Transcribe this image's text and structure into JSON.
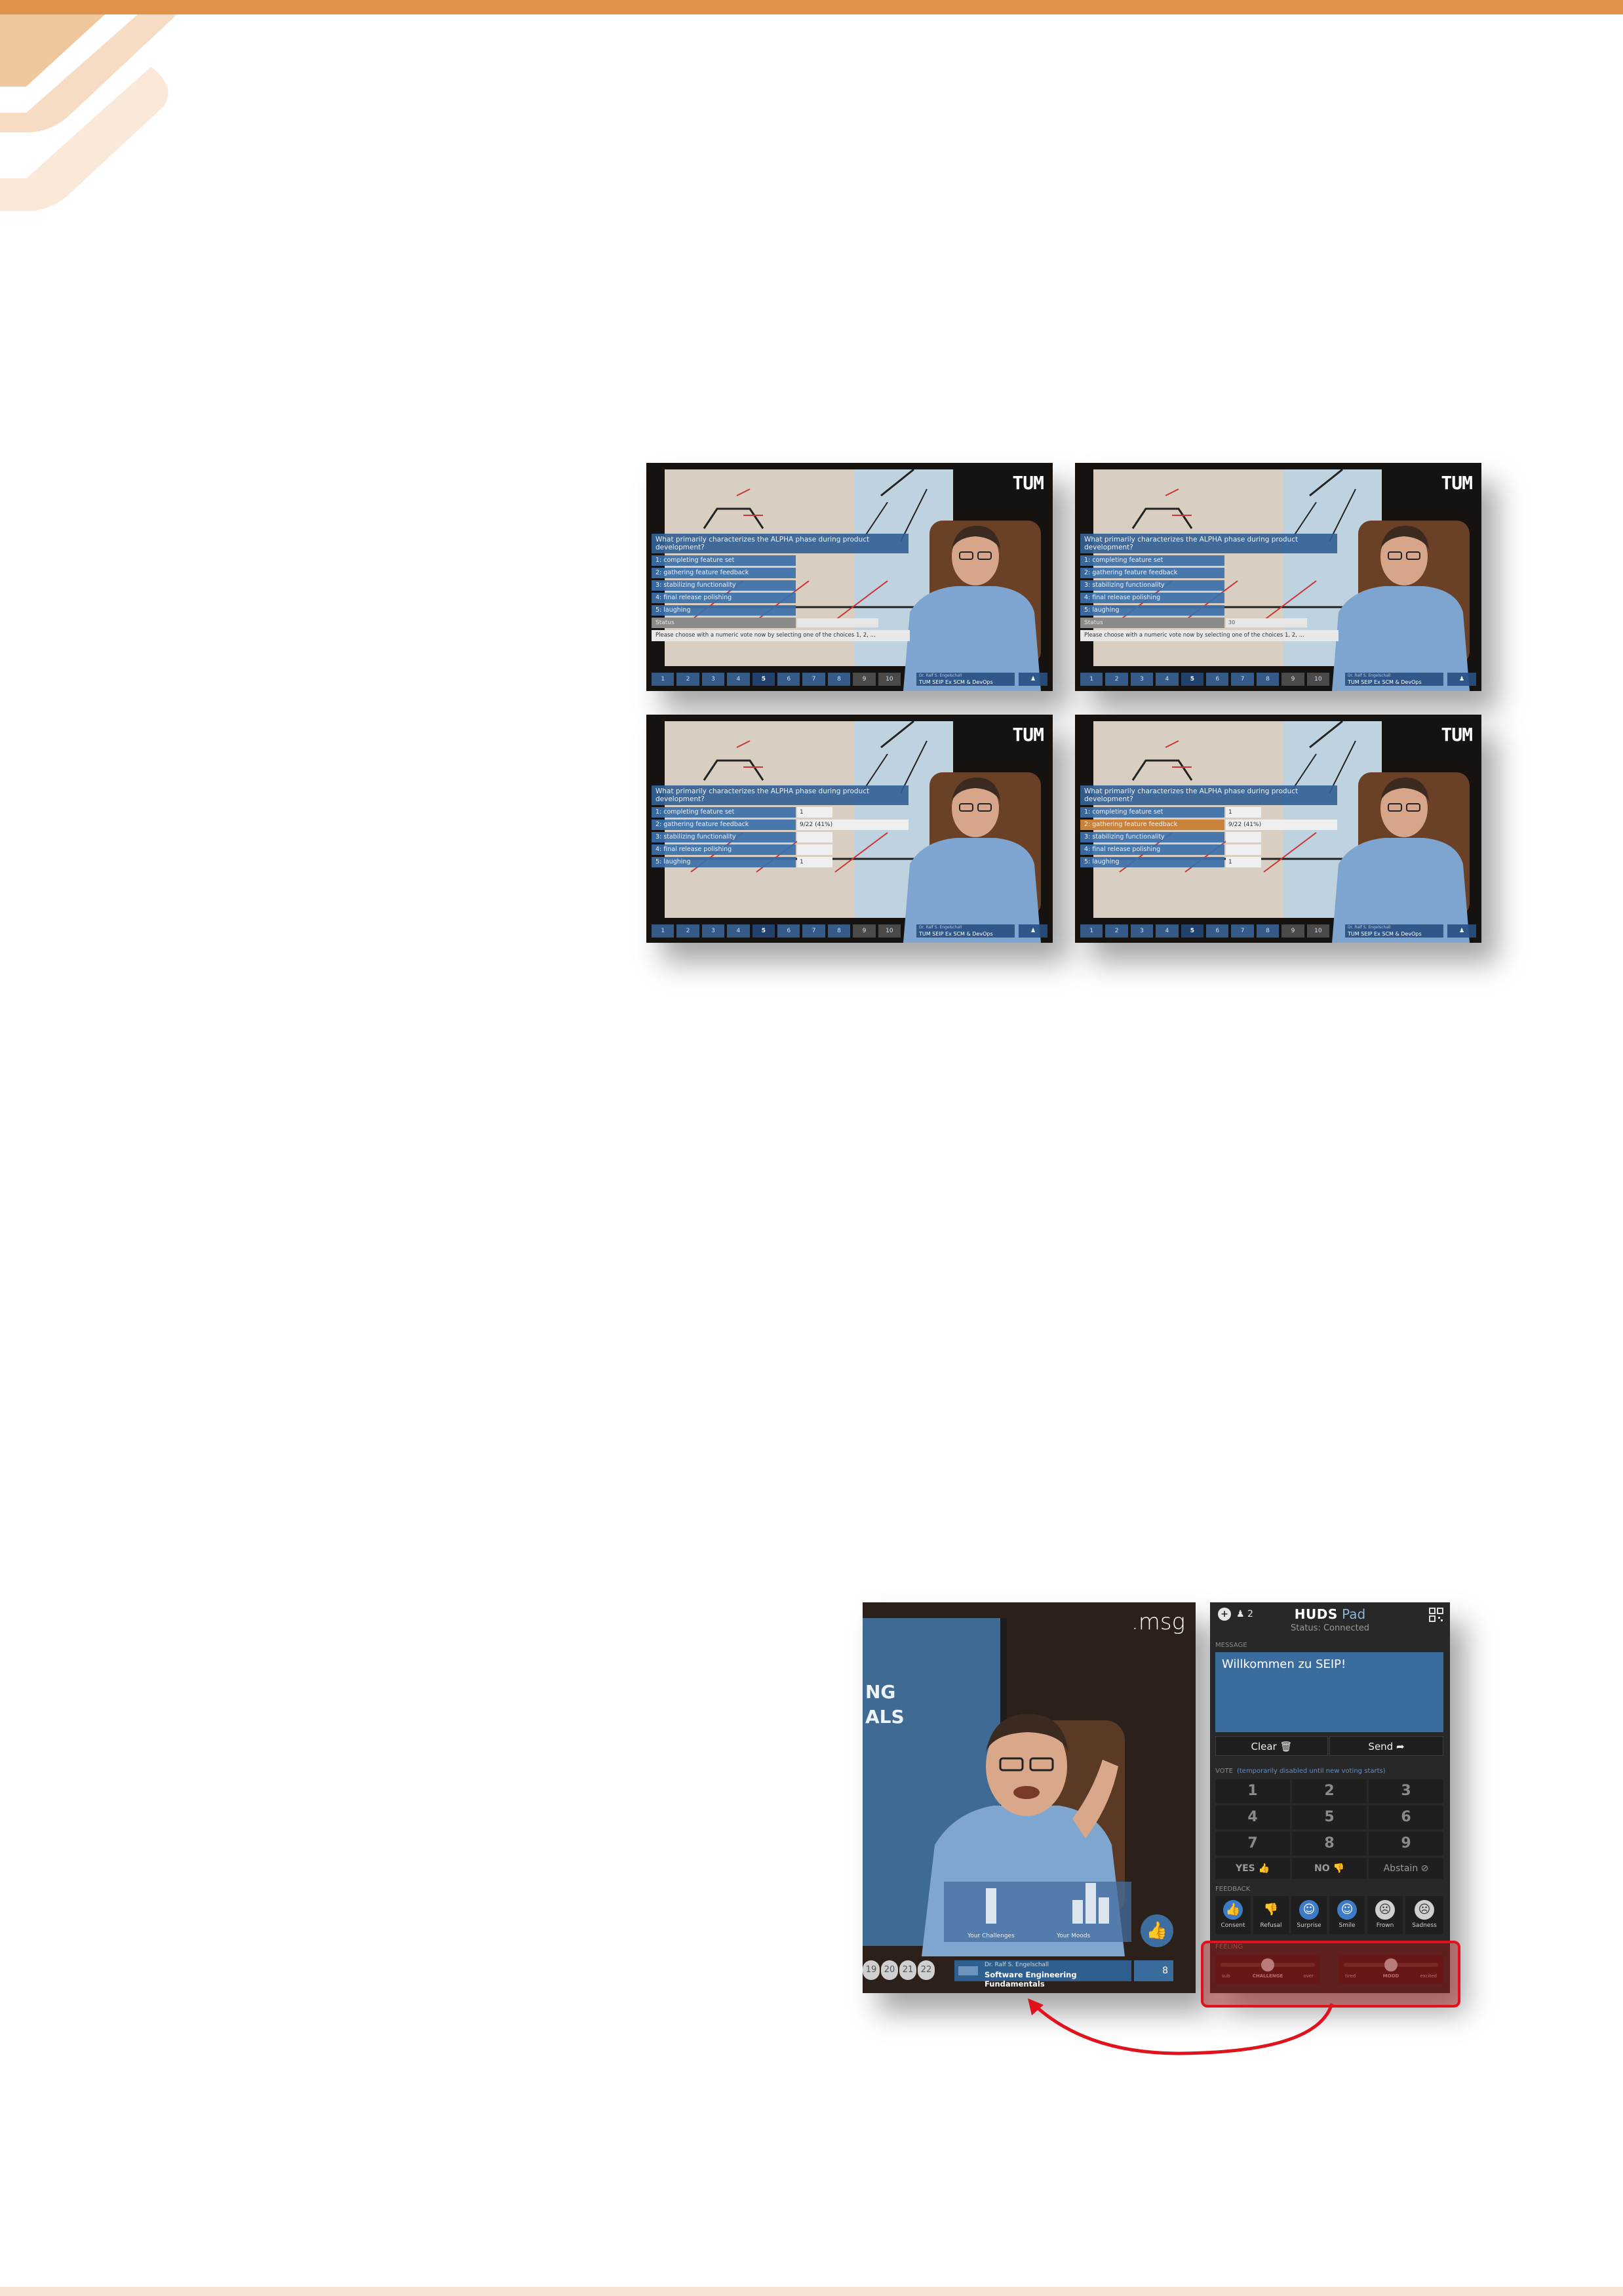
{
  "thumbnails": [
    {
      "logo": "TUM",
      "question": "What primarily characterizes the ALPHA phase during product development?",
      "choices": [
        "1: completing feature set",
        "2: gathering feature feedback",
        "3: stabilizing functionality",
        "4: final release polishing",
        "5: laughing"
      ],
      "results": [],
      "status_label": "Status",
      "status_value": "",
      "hint": "Please choose with a numeric vote now by selecting one of the choices 1, 2, ...",
      "nav": [
        "1",
        "2",
        "3",
        "4",
        "5",
        "6",
        "7",
        "8",
        "9",
        "10"
      ],
      "course": "TUM SEIP Ex SCM & DevOps",
      "course_sub": "Dr. Ralf S. Engelschall"
    },
    {
      "logo": "TUM",
      "question": "What primarily characterizes the ALPHA phase during product development?",
      "choices": [
        "1: completing feature set",
        "2: gathering feature feedback",
        "3: stabilizing functionality",
        "4: final release polishing",
        "5: laughing"
      ],
      "results": [],
      "status_label": "Status",
      "status_value": "30",
      "hint": "Please choose with a numeric vote now by selecting one of the choices 1, 2, ...",
      "nav": [
        "1",
        "2",
        "3",
        "4",
        "5",
        "6",
        "7",
        "8",
        "9",
        "10"
      ],
      "course": "TUM SEIP Ex SCM & DevOps",
      "course_sub": "Dr. Ralf S. Engelschall"
    },
    {
      "logo": "TUM",
      "question": "What primarily characterizes the ALPHA phase during product development?",
      "choices": [
        "1: completing feature set",
        "2: gathering feature feedback",
        "3: stabilizing functionality",
        "4: final release polishing",
        "5: laughing"
      ],
      "results": [
        "1",
        "9/22 (41%)",
        "",
        "",
        "1"
      ],
      "nav": [
        "1",
        "2",
        "3",
        "4",
        "5",
        "6",
        "7",
        "8",
        "9",
        "10"
      ],
      "course": "TUM SEIP Ex SCM & DevOps",
      "course_sub": "Dr. Ralf S. Engelschall"
    },
    {
      "logo": "TUM",
      "question": "What primarily characterizes the ALPHA phase during product development?",
      "choices": [
        "1: completing feature set",
        "2: gathering feature feedback",
        "3: stabilizing functionality",
        "4: final release polishing",
        "5: laughing"
      ],
      "results": [
        "1",
        "9/22 (41%)",
        "",
        "",
        "1"
      ],
      "selected_index": 1,
      "nav": [
        "1",
        "2",
        "3",
        "4",
        "5",
        "6",
        "7",
        "8",
        "9",
        "10"
      ],
      "course": "TUM SEIP Ex SCM & DevOps",
      "course_sub": "Dr. Ralf S. Engelschall"
    }
  ],
  "video": {
    "logo": ".msg",
    "board_lines": [
      "NG",
      "ALS"
    ],
    "challenge_label": "Your Challenges",
    "mood_label": "Your Moods",
    "challenge_bars": [
      0,
      1,
      0,
      0,
      0
    ],
    "mood_bars": [
      0,
      1,
      2,
      1,
      0
    ],
    "pages": [
      "19",
      "20",
      "21",
      "22"
    ],
    "course_sub": "Dr. Ralf S. Engelschall",
    "course_title": "Software Engineering Fundamentals",
    "user_count": "8"
  },
  "pad": {
    "users": "2",
    "title_bold": "HUDS",
    "title_light": "Pad",
    "status": "Status: Connected",
    "message_label": "MESSAGE",
    "message_text": "Willkommen zu SEIP!",
    "clear_label": "Clear",
    "send_label": "Send",
    "vote_label": "VOTE",
    "vote_hint": "(temporarily disabled until new voting starts)",
    "numbers": [
      "1",
      "2",
      "3",
      "4",
      "5",
      "6",
      "7",
      "8",
      "9"
    ],
    "yes_label": "YES",
    "no_label": "NO",
    "abstain_label": "Abstain",
    "feedback_label": "FEEDBACK",
    "feedback": [
      "Consent",
      "Refusal",
      "Surprise",
      "Smile",
      "Frown",
      "Sadness"
    ],
    "feeling_label": "FEELING",
    "challenge": {
      "left": "sub",
      "center": "CHALLENGE",
      "right": "over"
    },
    "mood": {
      "left": "tired",
      "center": "MOOD",
      "right": "excited"
    }
  },
  "colors": {
    "accent": "#e0914a",
    "highlight": "#e0121c",
    "pad_blue": "#3a6c9e"
  }
}
